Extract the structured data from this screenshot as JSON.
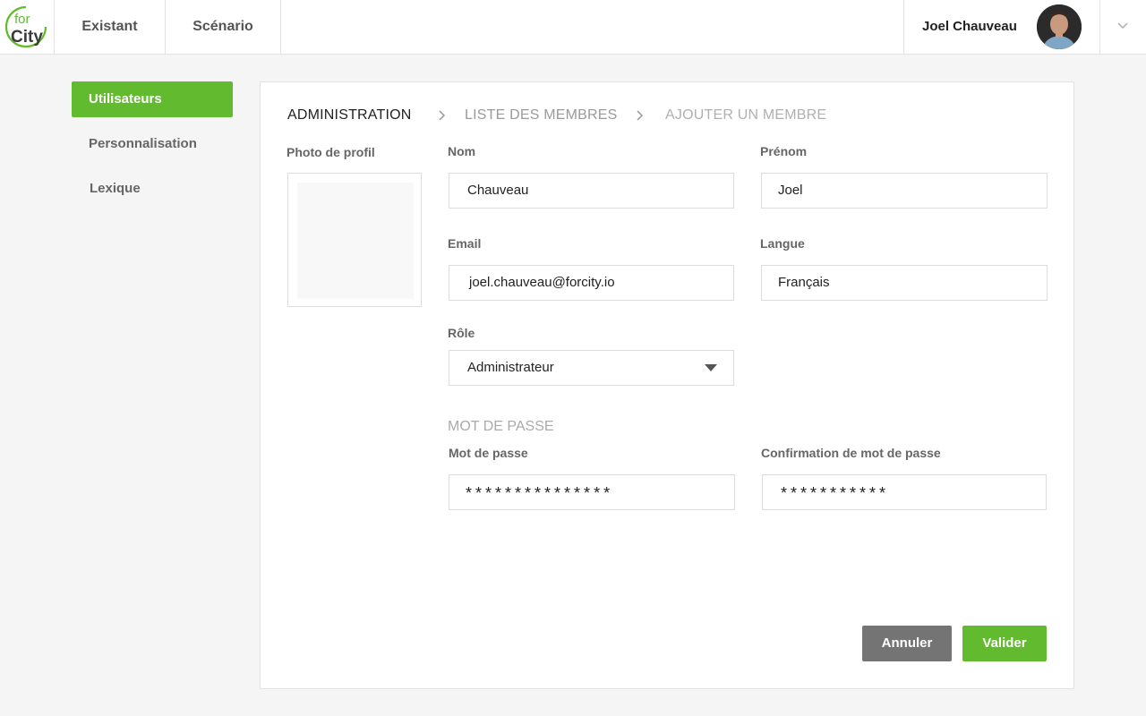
{
  "topbar": {
    "logo_line1": "for",
    "logo_line2": "City",
    "nav": [
      {
        "label": "Existant"
      },
      {
        "label": "Scénario"
      }
    ],
    "user_name": "Joel Chauveau"
  },
  "sidebar": {
    "items": [
      {
        "label": "Utilisateurs",
        "active": true
      },
      {
        "label": "Personnalisation",
        "active": false
      },
      {
        "label": "Lexique",
        "active": false
      }
    ]
  },
  "breadcrumb": [
    {
      "label": "ADMINISTRATION"
    },
    {
      "label": "LISTE DES MEMBRES"
    },
    {
      "label": "AJOUTER UN MEMBRE"
    }
  ],
  "form": {
    "photo_label": "Photo de profil",
    "nom": {
      "label": "Nom",
      "value": "Chauveau"
    },
    "prenom": {
      "label": "Prénom",
      "value": "Joel"
    },
    "email": {
      "label": "Email",
      "value": "joel.chauveau@forcity.io"
    },
    "langue": {
      "label": "Langue",
      "value": "Français"
    },
    "role": {
      "label": "Rôle",
      "value": "Administrateur"
    },
    "password_section": "MOT DE PASSE",
    "password": {
      "label": "Mot de passe",
      "value": "***************"
    },
    "password_confirm": {
      "label": "Confirmation de mot de passe",
      "value": "***********"
    }
  },
  "actions": {
    "cancel": "Annuler",
    "submit": "Valider"
  },
  "colors": {
    "accent": "#62bb2e",
    "cancel": "#747474"
  }
}
